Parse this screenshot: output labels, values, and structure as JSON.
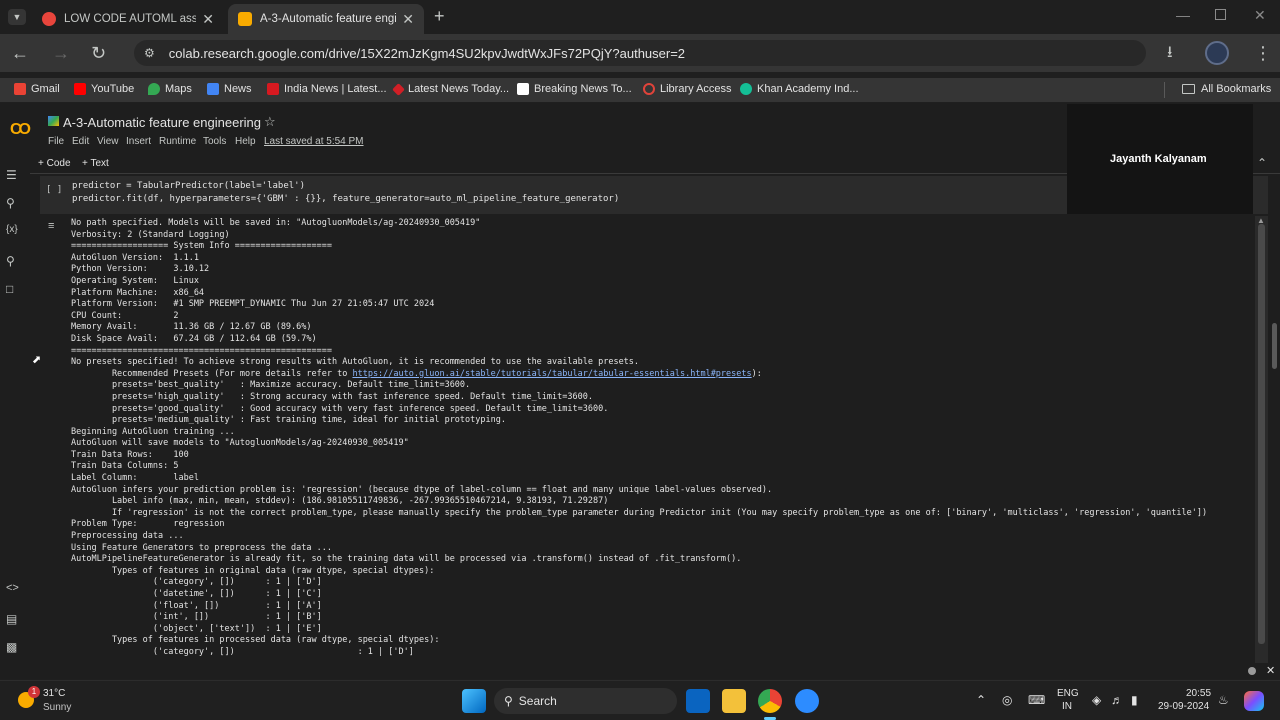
{
  "browser": {
    "tabs": [
      {
        "title": "LOW CODE AUTOML assign",
        "active": false,
        "favicon_color": "#e8453c"
      },
      {
        "title": "A-3-Automatic feature engir",
        "active": true,
        "favicon_color": "#f9ab00"
      }
    ],
    "new_tab": "+",
    "url": "colab.research.google.com/drive/15X22mJzKgm4SU2kpvJwdtWxJFs72PQjY?authuser=2",
    "bookmarks": [
      {
        "label": "Gmail",
        "color": "#ea4335"
      },
      {
        "label": "YouTube",
        "color": "#ff0000"
      },
      {
        "label": "Maps",
        "color": "#34a853"
      },
      {
        "label": "News",
        "color": "#4285f4"
      },
      {
        "label": "India News | Latest...",
        "color": "#d71920"
      },
      {
        "label": "Latest News Today...",
        "color": "#d11f26"
      },
      {
        "label": "Breaking News To...",
        "color": "#ffffff"
      },
      {
        "label": "Library Access",
        "color": "#e0433a"
      },
      {
        "label": "Khan Academy Ind...",
        "color": "#14bf96"
      }
    ],
    "all_bookmarks": "All Bookmarks"
  },
  "colab": {
    "notebook_title": "A-3-Automatic feature engineering",
    "menu": [
      "File",
      "Edit",
      "View",
      "Insert",
      "Runtime",
      "Tools",
      "Help"
    ],
    "last_saved": "Last saved at 5:54 PM",
    "add_code": "+ Code",
    "add_text": "+ Text",
    "cell_run": "[ ]",
    "code_lines": [
      "predictor = TabularPredictor(label='label')",
      "predictor.fit(df, hyperparameters={'GBM' : {}}, feature_generator=auto_ml_pipeline_feature_generator)"
    ],
    "output_link": "https://auto.gluon.ai/stable/tutorials/tabular/tabular-essentials.html#presets",
    "output_lines": [
      "No path specified. Models will be saved in: \"AutogluonModels/ag-20240930_005419\"",
      "Verbosity: 2 (Standard Logging)",
      "=================== System Info ===================",
      "AutoGluon Version:  1.1.1",
      "Python Version:     3.10.12",
      "Operating System:   Linux",
      "Platform Machine:   x86_64",
      "Platform Version:   #1 SMP PREEMPT_DYNAMIC Thu Jun 27 21:05:47 UTC 2024",
      "CPU Count:          2",
      "Memory Avail:       11.36 GB / 12.67 GB (89.6%)",
      "Disk Space Avail:   67.24 GB / 112.64 GB (59.7%)",
      "===================================================",
      "No presets specified! To achieve strong results with AutoGluon, it is recommended to use the available presets.",
      "        Recommended Presets (For more details refer to ",
      "        presets='best_quality'   : Maximize accuracy. Default time_limit=3600.",
      "        presets='high_quality'   : Strong accuracy with fast inference speed. Default time_limit=3600.",
      "        presets='good_quality'   : Good accuracy with very fast inference speed. Default time_limit=3600.",
      "        presets='medium_quality' : Fast training time, ideal for initial prototyping.",
      "Beginning AutoGluon training ...",
      "AutoGluon will save models to \"AutogluonModels/ag-20240930_005419\"",
      "Train Data Rows:    100",
      "Train Data Columns: 5",
      "Label Column:       label",
      "AutoGluon infers your prediction problem is: 'regression' (because dtype of label-column == float and many unique label-values observed).",
      "        Label info (max, min, mean, stddev): (186.98105511749836, -267.99365510467214, 9.38193, 71.29287)",
      "        If 'regression' is not the correct problem_type, please manually specify the problem_type parameter during Predictor init (You may specify problem_type as one of: ['binary', 'multiclass', 'regression', 'quantile'])",
      "Problem Type:       regression",
      "Preprocessing data ...",
      "Using Feature Generators to preprocess the data ...",
      "AutoMLPipelineFeatureGenerator is already fit, so the training data will be processed via .transform() instead of .fit_transform().",
      "        Types of features in original data (raw dtype, special dtypes):",
      "                ('category', [])      : 1 | ['D']",
      "                ('datetime', [])      : 1 | ['C']",
      "                ('float', [])         : 1 | ['A']",
      "                ('int', [])           : 1 | ['B']",
      "                ('object', ['text'])  : 1 | ['E']",
      "        Types of features in processed data (raw dtype, special dtypes):",
      "                ('category', [])                        : 1 | ['D']"
    ]
  },
  "overlay": {
    "name": "Jayanth Kalyanam"
  },
  "taskbar": {
    "weather_temp": "31°C",
    "weather_desc": "Sunny",
    "weather_badge": "1",
    "search": "Search",
    "lang1": "ENG",
    "lang2": "IN",
    "time": "20:55",
    "date": "29-09-2024"
  }
}
